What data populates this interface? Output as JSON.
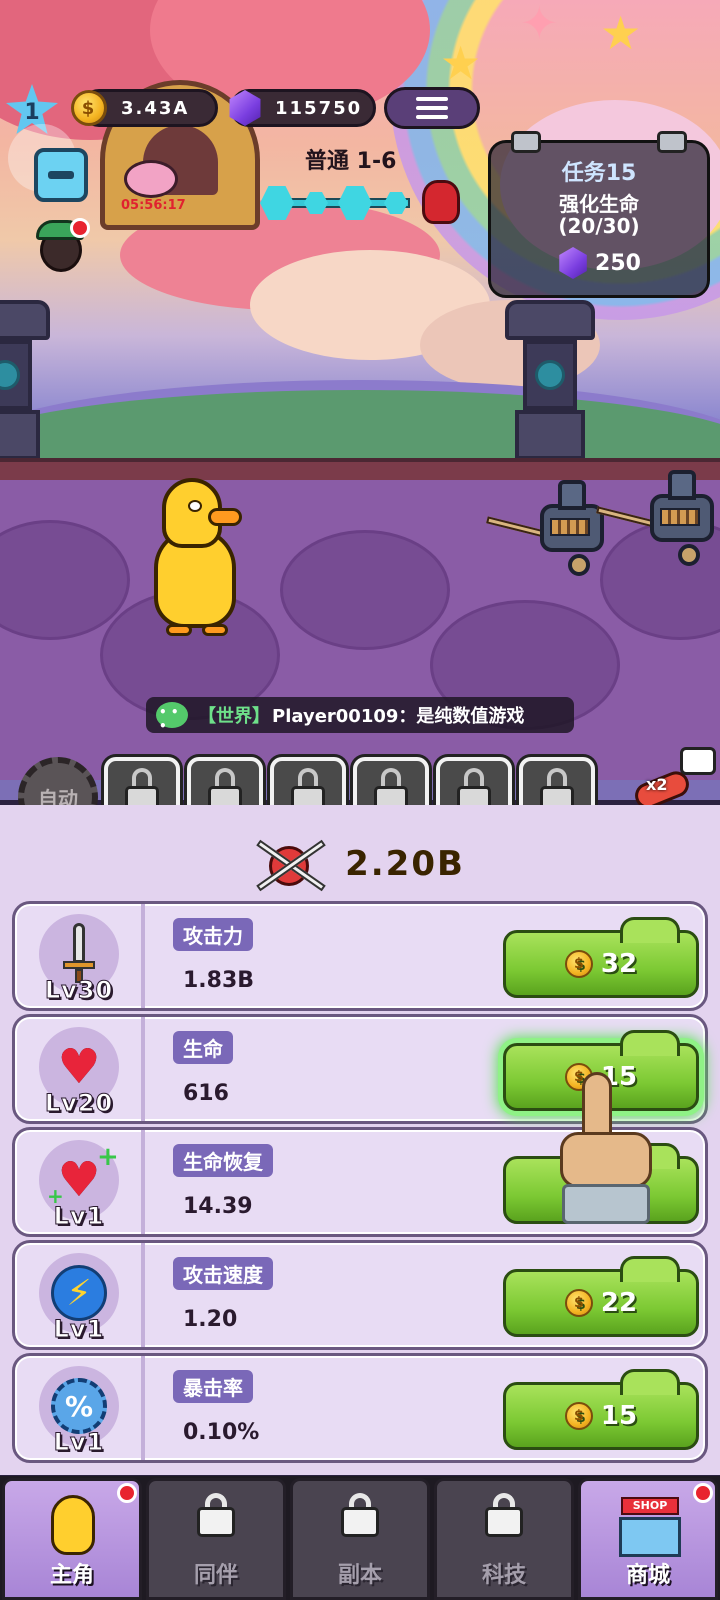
{
  "hud": {
    "player_level": "1",
    "gold": "3.43A",
    "gems": "115750",
    "speed_icon": "double-chevron-icon",
    "timer": "05:56:17"
  },
  "stage": {
    "title": "普通 1-6"
  },
  "quest": {
    "title": "任务15",
    "description": "强化生命",
    "progress": "(20/30)",
    "reward": "250"
  },
  "chat": {
    "channel": "【世界】",
    "message": "Player00109：是纯数值游戏"
  },
  "skills": {
    "auto_label": "自动",
    "locked_slots": 6,
    "speed_multiplier": "x2"
  },
  "power": {
    "value": "2.20B"
  },
  "stats": [
    {
      "name": "攻击力",
      "value": "1.83B",
      "level": "Lv30",
      "cost": "32",
      "icon": "sword-icon"
    },
    {
      "name": "生命",
      "value": "616",
      "level": "Lv20",
      "cost": "15",
      "icon": "heart-icon"
    },
    {
      "name": "生命恢复",
      "value": "14.39",
      "level": "Lv1",
      "cost": "",
      "icon": "heart-plus-icon"
    },
    {
      "name": "攻击速度",
      "value": "1.20",
      "level": "Lv1",
      "cost": "22",
      "icon": "lightning-icon"
    },
    {
      "name": "暴击率",
      "value": "0.10%",
      "level": "Lv1",
      "cost": "15",
      "icon": "crit-percent-icon"
    }
  ],
  "nav": {
    "hero": "主角",
    "partner": "同伴",
    "dungeon": "副本",
    "tech": "科技",
    "shop": "商城",
    "shop_sign": "SHOP"
  },
  "colors": {
    "upgrade_green": "#7cc933",
    "stat_label_bg": "#7a68b8",
    "panel_bg": "#e3d3ef",
    "timer_red": "#e0222f"
  }
}
